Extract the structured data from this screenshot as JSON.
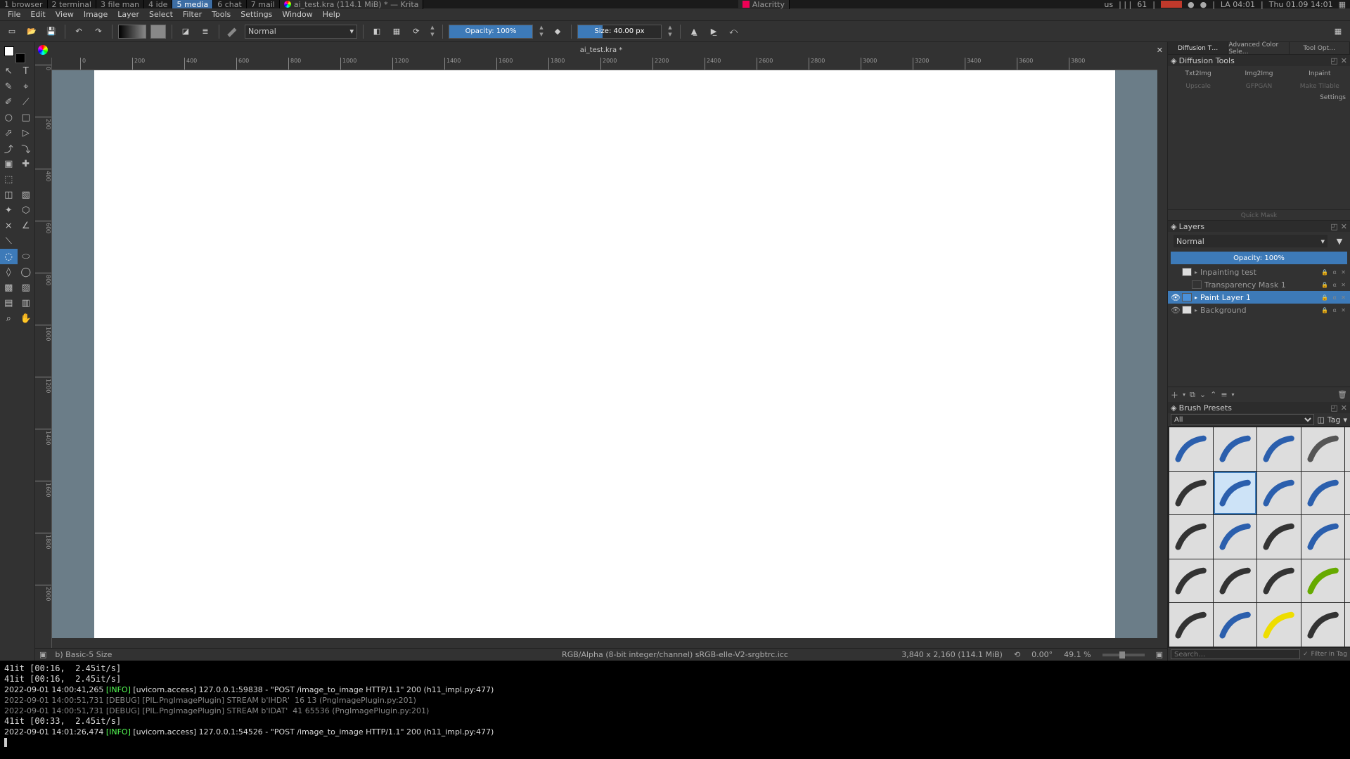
{
  "sysbar": {
    "tasks": [
      "1 browser",
      "2 terminal",
      "3 file man",
      "4 ide",
      "5 media",
      "6 chat",
      "7 mail"
    ],
    "active_task": 4,
    "app_title": "ai_test.kra (114.1 MiB)  * — Krita",
    "second_app": "Alacritty",
    "tray": {
      "kb": "us",
      "workspace": "61",
      "tz": "LA 04:01",
      "clock": "Thu 01.09 14:01"
    }
  },
  "menubar": [
    "File",
    "Edit",
    "View",
    "Image",
    "Layer",
    "Select",
    "Filter",
    "Tools",
    "Settings",
    "Window",
    "Help"
  ],
  "toolbar": {
    "blend_mode": "Normal",
    "opacity_label": "Opacity: 100%",
    "size_label": "Size: 40.00 px"
  },
  "tab": {
    "title": "ai_test.kra *"
  },
  "ruler": {
    "h_ticks": [
      0,
      200,
      400,
      600,
      800,
      1000,
      1200,
      1400,
      1600,
      1800,
      2000,
      2200,
      2400,
      2600,
      2800,
      3000,
      3200,
      3400,
      3600,
      3800
    ],
    "v_ticks": [
      0,
      200,
      400,
      600,
      800,
      1000,
      1200,
      1400,
      1600,
      1800,
      2000
    ]
  },
  "statusbar": {
    "brush": "b) Basic-5 Size",
    "profile": "RGB/Alpha (8-bit integer/channel)  sRGB-elle-V2-srgbtrc.icc",
    "dims": "3,840 x 2,160 (114.1 MiB)",
    "rotation": "0.00°",
    "zoom": "49.1 %"
  },
  "dock_tabs_top": [
    "Diffusion T…",
    "Advanced Color Sele…",
    "Tool Opt…"
  ],
  "diffusion": {
    "panel_title": "Diffusion Tools",
    "row1": [
      "Txt2Img",
      "Img2Img",
      "Inpaint"
    ],
    "row2": [
      "Upscale",
      "GFPGAN",
      "Make Tilable"
    ],
    "settings": "Settings"
  },
  "quick_mask": "Quick Mask",
  "layers": {
    "title": "Layers",
    "blend": "Normal",
    "opacity": "Opacity: 100%",
    "items": [
      {
        "name": "Inpainting test",
        "visible": false,
        "selected": false,
        "child": false,
        "thumb": "plain"
      },
      {
        "name": "Transparency Mask 1",
        "visible": false,
        "selected": false,
        "child": true,
        "thumb": "mask"
      },
      {
        "name": "Paint Layer 1",
        "visible": true,
        "selected": true,
        "child": false,
        "thumb": "paint"
      },
      {
        "name": "Background",
        "visible": true,
        "selected": false,
        "child": false,
        "thumb": "plain"
      }
    ]
  },
  "brush_presets": {
    "title": "Brush Presets",
    "filter": "All",
    "tag_label": "Tag",
    "search_placeholder": "Search…",
    "filter_tag": "Filter in Tag",
    "selected_index": 6
  },
  "terminal_lines": [
    "41it [00:16,  2.45it/s]",
    "41it [00:16,  2.45it/s]",
    "2022-09-01 14:00:41,265 [INFO] [uvicorn.access] 127.0.0.1:59838 - \"POST /image_to_image HTTP/1.1\" 200 (h11_impl.py:477)",
    "2022-09-01 14:00:51,731 [DEBUG] [PIL.PngImagePlugin] STREAM b'IHDR'  16 13 (PngImagePlugin.py:201)",
    "2022-09-01 14:00:51,731 [DEBUG] [PIL.PngImagePlugin] STREAM b'IDAT'  41 65536 (PngImagePlugin.py:201)",
    "41it [00:33,  2.45it/s]",
    "2022-09-01 14:01:26,474 [INFO] [uvicorn.access] 127.0.0.1:54526 - \"POST /image_to_image HTTP/1.1\" 200 (h11_impl.py:477)"
  ],
  "icons": {
    "new": "▱",
    "open": "▭",
    "save": "∎",
    "undo": "↶",
    "redo": "↷",
    "eraser": "◧",
    "alpha": "▦",
    "reload": "⟳",
    "mirror_h": "⇋",
    "mirror_v": "⇵",
    "wrap": "↺",
    "tools": [
      "↖",
      "T",
      "✎",
      "⌖",
      "✐",
      "⟋",
      "○",
      "□",
      "⬀",
      "▷",
      "⤴",
      "⤵",
      "▣",
      "✚",
      "⬚",
      "",
      "◫",
      "▧",
      "✦",
      "⬡",
      "⨯",
      "∠",
      "⟍",
      "",
      "◌",
      "⬭",
      "◊",
      "◯",
      "▩",
      "▨",
      "▤",
      "▥",
      "⌕",
      "✋"
    ]
  }
}
